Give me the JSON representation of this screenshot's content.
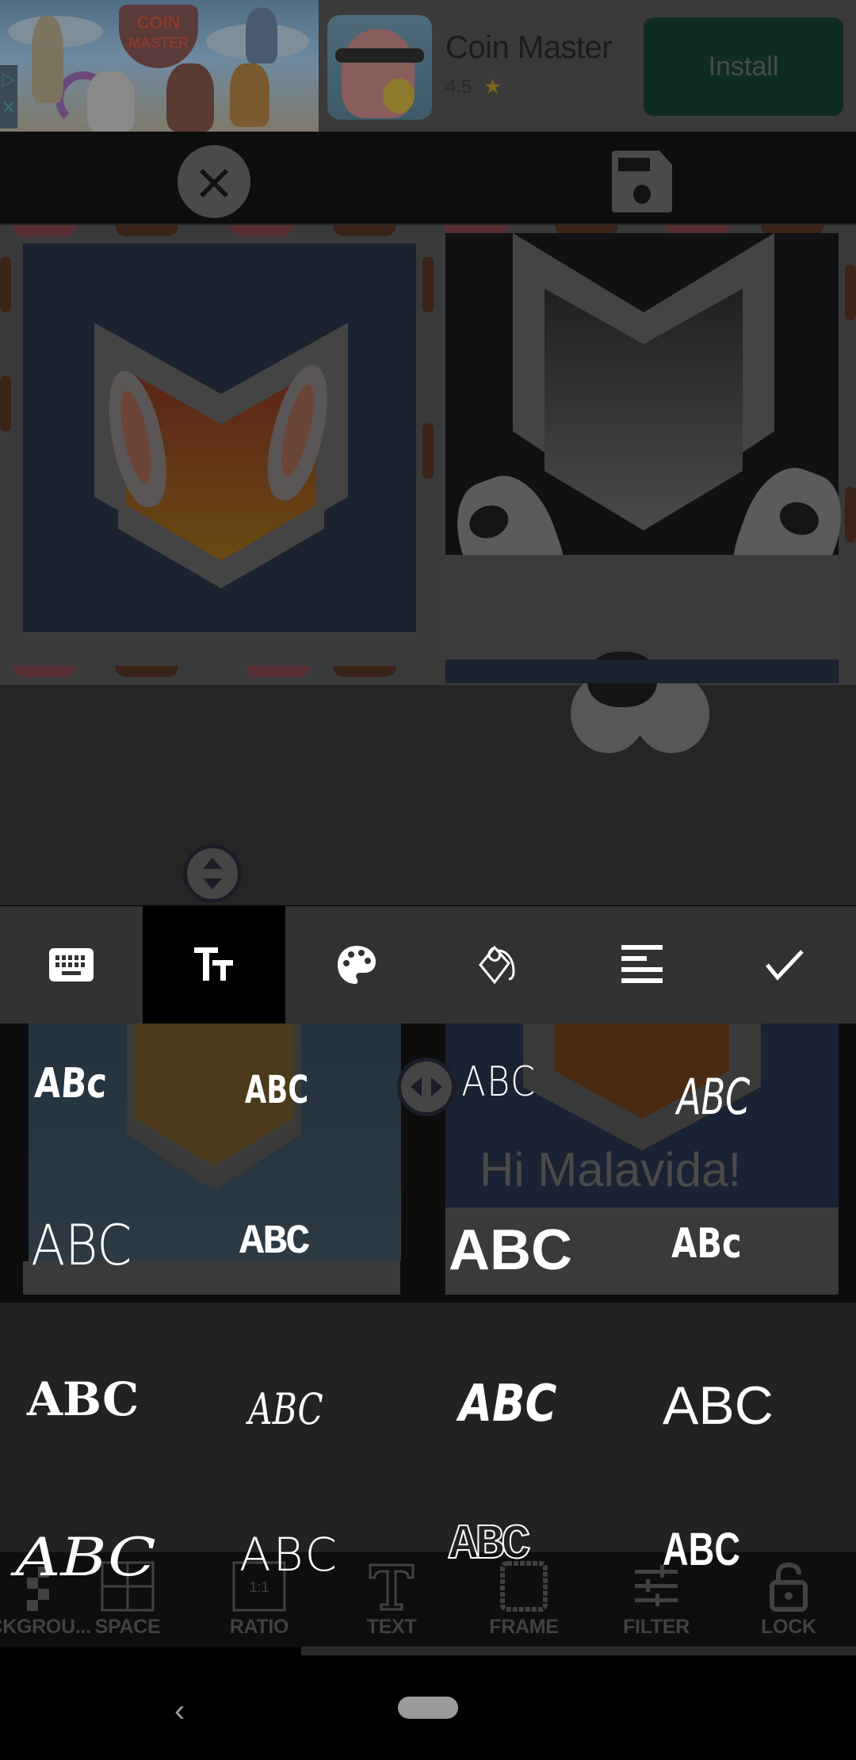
{
  "ad": {
    "app_name": "Coin Master",
    "rating": "4.5",
    "rating_icon": "star-icon",
    "install_label": "Install",
    "hero_logo_line1": "COIN",
    "hero_logo_line2": "MASTER",
    "adchoices_icon": "adchoices-icon",
    "close_icon": "close-icon",
    "colors": {
      "install_bg": "#0f2c24",
      "star": "#806318"
    }
  },
  "topbar": {
    "close_icon": "close-circle-icon",
    "save_icon": "floppy-disk-icon"
  },
  "canvas": {
    "overlay_text": "Hi Malavida!",
    "handle_vertical_icon": "resize-vertical-icon",
    "handle_horizontal_icon": "resize-horizontal-icon"
  },
  "text_tools": {
    "active_index": 1,
    "items": [
      {
        "name": "keyboard",
        "icon": "keyboard-icon"
      },
      {
        "name": "font",
        "icon": "text-size-icon"
      },
      {
        "name": "color",
        "icon": "palette-icon"
      },
      {
        "name": "background-fill",
        "icon": "paint-bucket-icon"
      },
      {
        "name": "align",
        "icon": "align-left-icon"
      },
      {
        "name": "confirm",
        "icon": "checkmark-icon"
      }
    ]
  },
  "font_grid": {
    "sample_text": "ABC",
    "items": [
      {
        "label": "ABc",
        "style": "handwritten-bold"
      },
      {
        "label": "ABC",
        "style": "marker"
      },
      {
        "label": "ABC",
        "style": "thin-sans"
      },
      {
        "label": "ABC",
        "style": "brush-italic"
      },
      {
        "label": "ABC",
        "style": "light-sans"
      },
      {
        "label": "ABC",
        "style": "digital-lcd"
      },
      {
        "label": "ABC",
        "style": "bold-sans"
      },
      {
        "label": "ABc",
        "style": "comic-bold"
      },
      {
        "label": "ABC",
        "style": "typewriter-distressed"
      },
      {
        "label": "ABC",
        "style": "script-italic"
      },
      {
        "label": "ABC",
        "style": "rounded-bold"
      },
      {
        "label": "ABC",
        "style": "regular-sans"
      },
      {
        "label": "ABC",
        "style": "calligraphy"
      },
      {
        "label": "ABC",
        "style": "thin-wide"
      },
      {
        "label": "ABC",
        "style": "dotted-outline"
      },
      {
        "label": "ABC",
        "style": "condensed-bold"
      }
    ]
  },
  "bottom_nav": {
    "items": [
      {
        "label": "BACKGROU...",
        "icon": "checkerboard-icon"
      },
      {
        "label": "SPACE",
        "icon": "grid-icon"
      },
      {
        "label": "RATIO",
        "icon": "aspect-ratio-icon",
        "icon_text": "1:1"
      },
      {
        "label": "TEXT",
        "icon": "text-icon"
      },
      {
        "label": "FRAME",
        "icon": "frame-icon"
      },
      {
        "label": "FILTER",
        "icon": "sliders-icon"
      },
      {
        "label": "LOCK",
        "icon": "unlock-icon"
      }
    ]
  },
  "system_nav": {
    "back_icon": "back-chevron-icon",
    "home_icon": "home-pill-icon"
  }
}
